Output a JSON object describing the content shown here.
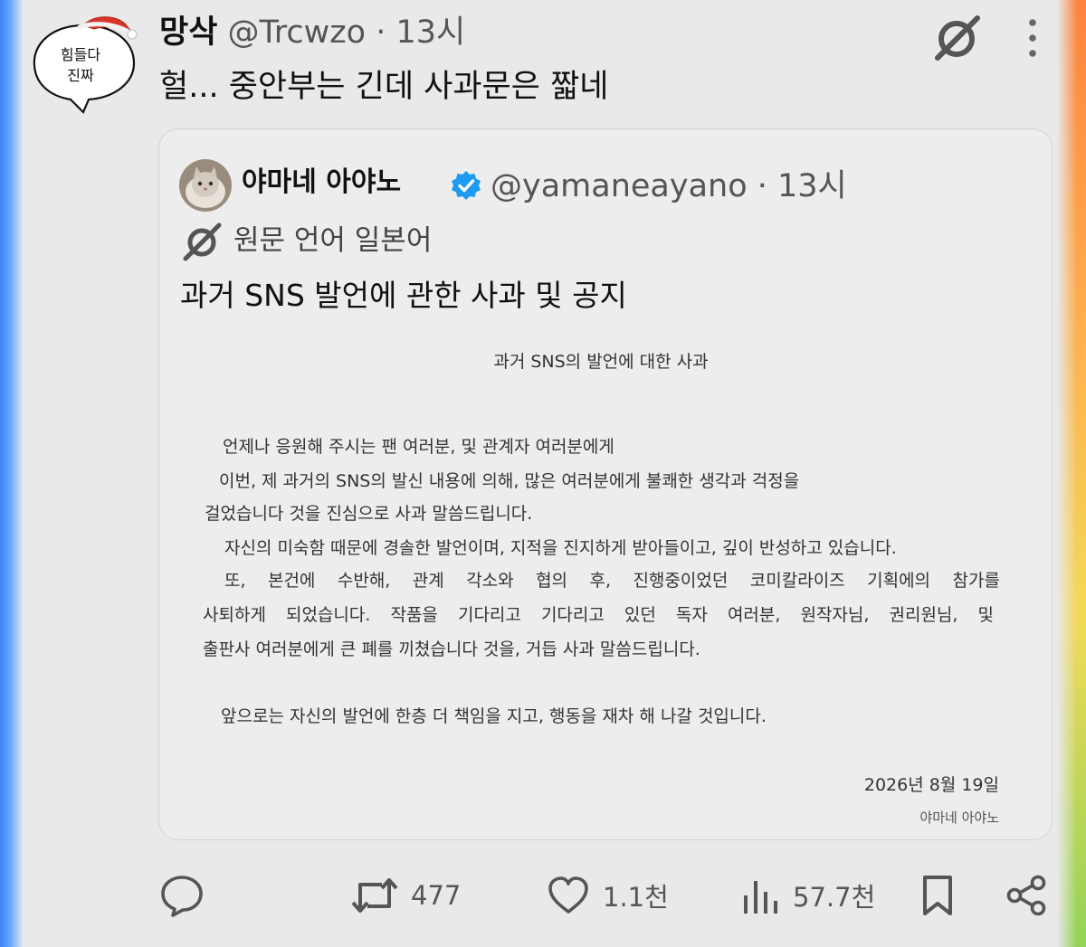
{
  "tweet": {
    "avatar_text_line1": "힘들다",
    "avatar_text_line2": "진짜",
    "author_name": "망삭",
    "author_handle": "@Trcwzo",
    "time_sep": " · ",
    "time": "13시",
    "text": "헐... 중안부는 긴데 사과문은 짧네",
    "icons": [
      "grok-translate-icon",
      "more-vertical-icon"
    ]
  },
  "quote": {
    "author_name": "야마네 아야노",
    "verified": true,
    "author_handle": "@yamaneayano",
    "time_sep": " · ",
    "time": "13시",
    "language_note": "원문 언어 일본어",
    "title": "과거 SNS 발언에 관한 사과 및 공지",
    "document": {
      "heading": "과거 SNS의 발언에 대한 사과",
      "line1": "언제나 응원해 주시는 팬 여러분, 및 관계자 여러분에게",
      "line2": "이번, 제 과거의 SNS의 발신 내용에 의해, 많은 여러분에게 불쾌한 생각과 걱정을",
      "line3": "걸었습니다 것을 진심으로 사과 말씀드립니다.",
      "line4": "자신의 미숙함 때문에 경솔한 발언이며, 지적을 진지하게 받아들이고, 깊이 반성하고 있습니다.",
      "line5_words": [
        "또,",
        "본건에",
        "수반해,",
        "관계",
        "각소와",
        "협의",
        "후,",
        "진행중이었던",
        "코미칼라이즈",
        "기획에의",
        "참가를"
      ],
      "line6_words": [
        "사퇴하게",
        "되었습니다.",
        "작품을",
        "기다리고",
        "기다리고",
        "있던",
        "독자",
        "여러분,",
        "원작자님,",
        "권리원님,",
        "및"
      ],
      "line7": "출판사 여러분에게 큰 폐를 끼쳤습니다 것을, 거듭 사과 말씀드립니다.",
      "line8": "앞으로는 자신의 발언에 한층 더 책임을 지고, 행동을 재차 해 나갈 것입니다.",
      "date": "2026년 8월 19일",
      "signature": "야마네 아야노"
    }
  },
  "actions": {
    "reply_count": "",
    "retweet_count": "477",
    "like_count": "1.1천",
    "views_count": "57.7천",
    "colors": {
      "icon": "#555555",
      "verified": "#1d9bf0"
    }
  }
}
